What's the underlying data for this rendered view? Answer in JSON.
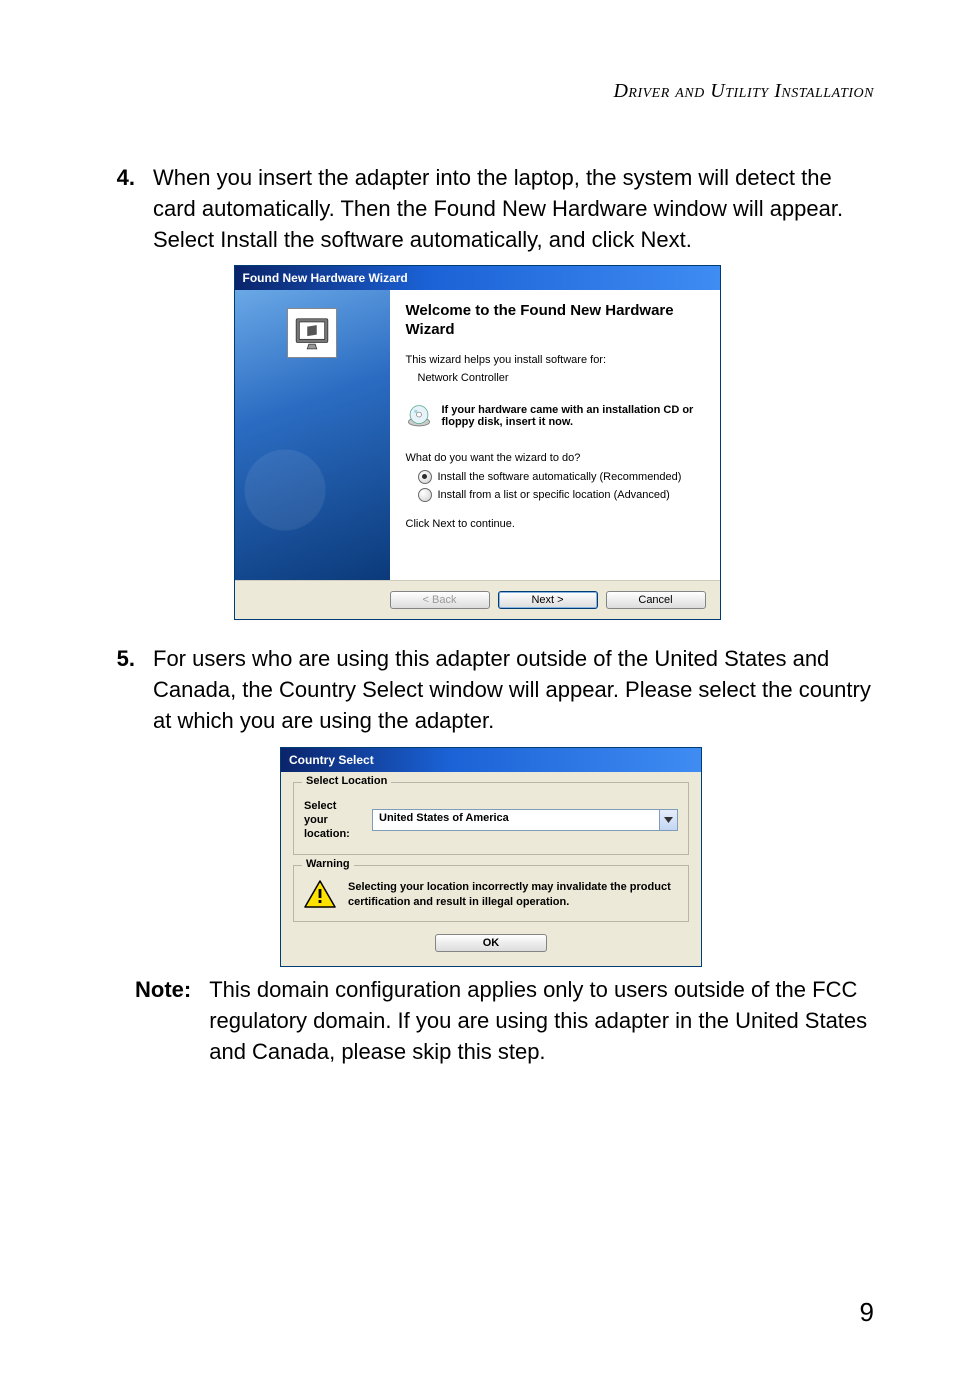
{
  "header": {
    "title": "Driver and Utility Installation"
  },
  "steps": {
    "s4": {
      "num": "4.",
      "text": "When you insert the adapter into the laptop, the system will detect the card automatically. Then the Found New Hardware window will appear. Select Install the software automatically, and click Next."
    },
    "s5": {
      "num": "5.",
      "text": "For users who are using this adapter outside of the United States and Canada, the Country Select window will appear. Please select the country at which you are using the adapter."
    }
  },
  "note": {
    "label": "Note:",
    "text": "This domain configuration applies only to users outside of the FCC regulatory domain. If you are using this adapter in the United States and Canada, please skip this step."
  },
  "page_number": "9",
  "wizard": {
    "title": "Found New Hardware Wizard",
    "welcome": "Welcome to the Found New Hardware Wizard",
    "help_line": "This wizard helps you install software for:",
    "device": "Network Controller",
    "cd_note": "If your hardware came with an installation CD or floppy disk, insert it now.",
    "prompt": "What do you want the wizard to do?",
    "opt_auto": "Install the software automatically (Recommended)",
    "opt_list": "Install from a list or specific location (Advanced)",
    "click_next": "Click Next to continue.",
    "btn_back": "< Back",
    "btn_next": "Next >",
    "btn_cancel": "Cancel"
  },
  "country": {
    "title": "Country Select",
    "group_location": "Select Location",
    "label_select": "Select your location:",
    "dropdown_value": "United States of America",
    "group_warning": "Warning",
    "warning_text": "Selecting your location incorrectly may invalidate the product certification and result in illegal operation.",
    "btn_ok": "OK"
  }
}
